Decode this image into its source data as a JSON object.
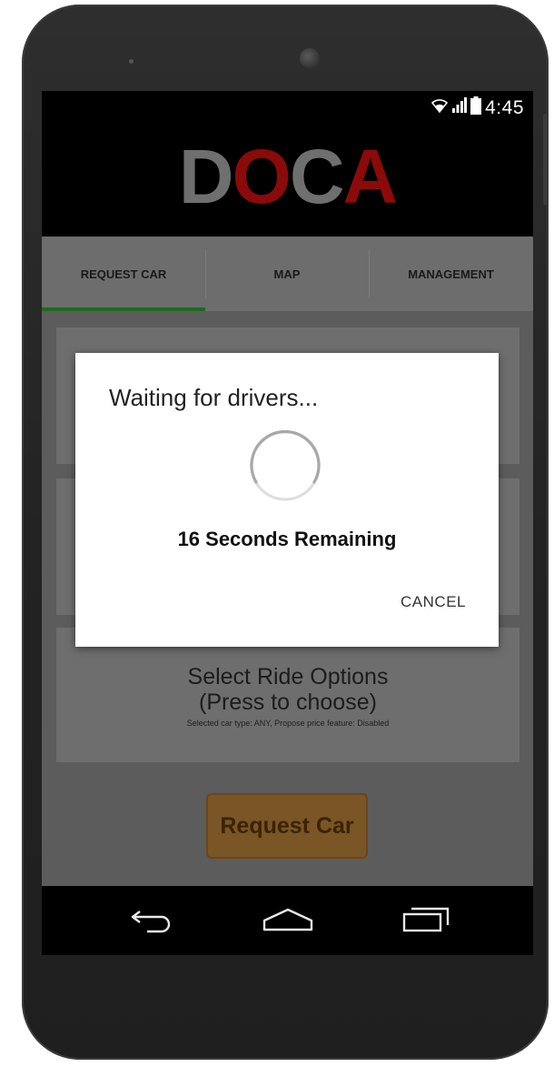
{
  "status_bar": {
    "time": "4:45",
    "icons": [
      "wifi-icon",
      "signal-icon",
      "battery-icon"
    ]
  },
  "app": {
    "logo_letters": [
      {
        "char": "D",
        "color": "#6f6f6f"
      },
      {
        "char": "O",
        "color": "#8b0a0a"
      },
      {
        "char": "C",
        "color": "#6f6f6f"
      },
      {
        "char": "A",
        "color": "#8b0a0a"
      }
    ]
  },
  "tabs": [
    {
      "label": "REQUEST CAR",
      "active": true
    },
    {
      "label": "MAP",
      "active": false
    },
    {
      "label": "MANAGEMENT",
      "active": false
    }
  ],
  "ride_options": {
    "title": "Select Ride Options",
    "subtitle": "(Press to choose)",
    "details": "Selected car type: ANY, Propose price feature: Disabled"
  },
  "request_button": {
    "label": "Request Car"
  },
  "dialog": {
    "title": "Waiting for drivers...",
    "remaining": "16 Seconds Remaining",
    "cancel_label": "CANCEL"
  },
  "navbar": {
    "icons": [
      "back-icon",
      "home-icon",
      "recent-apps-icon"
    ]
  },
  "colors": {
    "accent_indicator": "#1f6a1f",
    "button_bg": "#7a5526",
    "dialog_bg": "#ffffff"
  }
}
